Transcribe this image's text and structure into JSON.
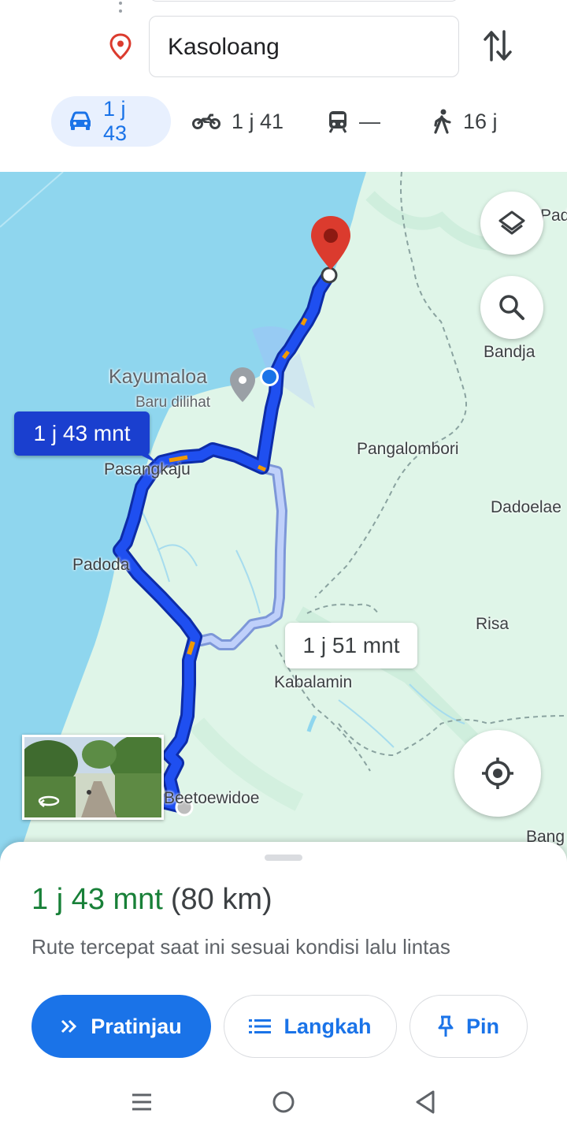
{
  "directions": {
    "destination": "Kasoloang",
    "modes": [
      {
        "icon": "car-icon",
        "label": "1 j 43",
        "active": true
      },
      {
        "icon": "motorcycle-icon",
        "label": "1 j 41",
        "active": false
      },
      {
        "icon": "train-icon",
        "label": "—",
        "active": false
      },
      {
        "icon": "walk-icon",
        "label": "16 j",
        "active": false
      }
    ]
  },
  "map": {
    "labels": {
      "kayumaloa": "Kayumaloa",
      "kayumaloa_sub": "Baru dilihat",
      "pasangkaju": "Pasangkaju",
      "padoda": "Padoda",
      "pangalombori": "Pangalombori",
      "dadoelae": "Dadoelae",
      "risa": "Risa",
      "kabalamin": "Kabalamin",
      "beetoewidoe": "Beetoewidoe",
      "bandja": "Bandja",
      "pad": "Pad",
      "bang": "Bang"
    },
    "route_main_time": "1 j 43 mnt",
    "route_alt_time": "1 j 51 mnt",
    "colors": {
      "route": "#1a3fe0",
      "alt_route": "#a9bff5",
      "water": "#8fd6ee",
      "land": "#dff5e8",
      "pin": "#db3b2e"
    }
  },
  "sheet": {
    "duration": "1 j 43 mnt",
    "distance": "(80 km)",
    "subtitle": "Rute tercepat saat ini sesuai kondisi lalu lintas",
    "buttons": {
      "preview": "Pratinjau",
      "steps": "Langkah",
      "pin": "Pin"
    }
  }
}
